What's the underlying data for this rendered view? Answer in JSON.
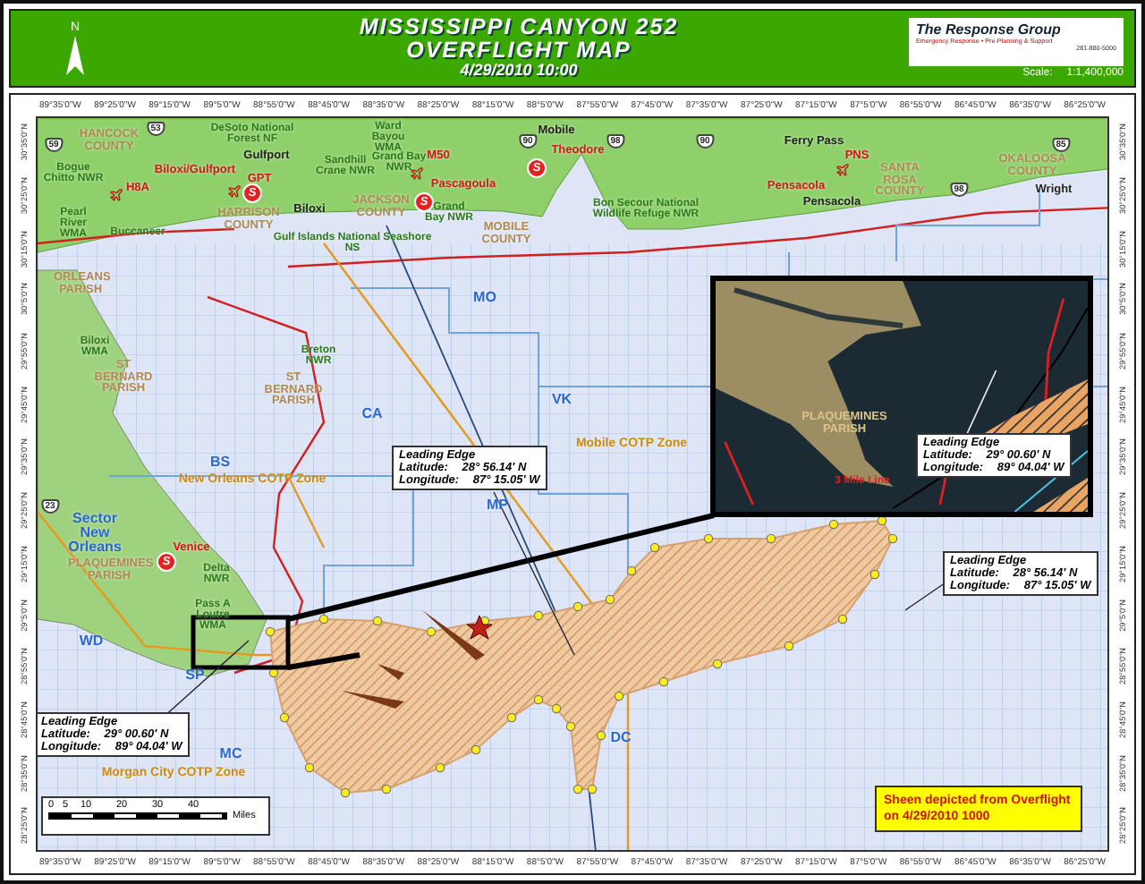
{
  "header": {
    "title_lines": [
      "MISSISSIPPI CANYON 252",
      "OVERFLIGHT MAP"
    ],
    "datetime": "4/29/2010 10:00",
    "north_label": "N",
    "logo": {
      "name": "The Response Group",
      "tagline": "Emergency Response • Pre-Planning & Support",
      "phone": "281-880-5000"
    },
    "scale_label": "Scale:",
    "scale_value": "1:1,400,000"
  },
  "map": {
    "lon_ticks_top": [
      "89°35'0\"W",
      "89°25'0\"W",
      "89°15'0\"W",
      "89°5'0\"W",
      "88°55'0\"W",
      "88°45'0\"W",
      "88°35'0\"W",
      "88°25'0\"W",
      "88°15'0\"W",
      "88°5'0\"W",
      "87°55'0\"W",
      "87°45'0\"W",
      "87°35'0\"W",
      "87°25'0\"W",
      "87°15'0\"W",
      "87°5'0\"W",
      "86°55'0\"W",
      "86°45'0\"W",
      "86°35'0\"W",
      "86°25'0\"W"
    ],
    "lon_ticks_bottom": [
      "89°35'0\"W",
      "89°25'0\"W",
      "89°15'0\"W",
      "89°5'0\"W",
      "88°55'0\"W",
      "88°45'0\"W",
      "88°35'0\"W",
      "88°25'0\"W",
      "88°15'0\"W",
      "88°5'0\"W",
      "87°55'0\"W",
      "87°45'0\"W",
      "87°35'0\"W",
      "87°25'0\"W",
      "87°15'0\"W",
      "87°5'0\"W",
      "86°55'0\"W",
      "86°45'0\"W",
      "86°35'0\"W",
      "86°25'0\"W"
    ],
    "lat_ticks_left": [
      "30°35'0\"N",
      "30°25'0\"N",
      "30°15'0\"N",
      "30°5'0\"N",
      "29°55'0\"N",
      "29°45'0\"N",
      "29°35'0\"N",
      "29°25'0\"N",
      "29°15'0\"N",
      "29°5'0\"N",
      "28°55'0\"N",
      "28°45'0\"N",
      "28°35'0\"N",
      "28°25'0\"N"
    ],
    "lat_ticks_right": [
      "30°35'0\"N",
      "30°25'0\"N",
      "30°15'0\"N",
      "30°5'0\"N",
      "29°55'0\"N",
      "29°45'0\"N",
      "29°35'0\"N",
      "29°25'0\"N",
      "29°15'0\"N",
      "29°5'0\"N",
      "28°55'0\"N",
      "28°45'0\"N",
      "28°35'0\"N",
      "28°25'0\"N"
    ],
    "place_labels": [
      {
        "text": "Bogue Chitto NWR",
        "kind": "land"
      },
      {
        "text": "HANCOCK COUNTY",
        "kind": "parish"
      },
      {
        "text": "DeSoto National Forest NF",
        "kind": "land"
      },
      {
        "text": "Ward Bayou WMA",
        "kind": "land"
      },
      {
        "text": "Mobile",
        "kind": "town"
      },
      {
        "text": "Theodore",
        "kind": "city"
      },
      {
        "text": "Ferry Pass",
        "kind": "town"
      },
      {
        "text": "PNS",
        "kind": "city"
      },
      {
        "text": "SANTA ROSA COUNTY",
        "kind": "parish"
      },
      {
        "text": "OKALOOSA COUNTY",
        "kind": "parish"
      },
      {
        "text": "Wright",
        "kind": "town"
      },
      {
        "text": "Biloxi/Gulfport",
        "kind": "city"
      },
      {
        "text": "Gulfport",
        "kind": "town"
      },
      {
        "text": "GPT",
        "kind": "city"
      },
      {
        "text": "Sandhill Crane NWR",
        "kind": "land"
      },
      {
        "text": "Grand Bay NWR",
        "kind": "land"
      },
      {
        "text": "M50",
        "kind": "city"
      },
      {
        "text": "Pascagoula",
        "kind": "city"
      },
      {
        "text": "Grand Bay NWR",
        "kind": "land"
      },
      {
        "text": "H8A",
        "kind": "city"
      },
      {
        "text": "Bon Secour National Wildlife Refuge NWR",
        "kind": "land"
      },
      {
        "text": "Pensacola",
        "kind": "city"
      },
      {
        "text": "Pensacola",
        "kind": "town"
      },
      {
        "text": "Pearl River WMA",
        "kind": "land"
      },
      {
        "text": "Buccaneer",
        "kind": "land"
      },
      {
        "text": "HARRISON COUNTY",
        "kind": "parish"
      },
      {
        "text": "Biloxi",
        "kind": "town"
      },
      {
        "text": "JACKSON COUNTY",
        "kind": "parish"
      },
      {
        "text": "MOBILE COUNTY",
        "kind": "parish"
      },
      {
        "text": "Gulf Islands National Seashore NS",
        "kind": "land"
      },
      {
        "text": "ORLEANS PARISH",
        "kind": "parish"
      },
      {
        "text": "MO",
        "kind": "area"
      },
      {
        "text": "Biloxi WMA",
        "kind": "land"
      },
      {
        "text": "ST BERNARD PARISH",
        "kind": "parish"
      },
      {
        "text": "Breton NWR",
        "kind": "land"
      },
      {
        "text": "ST BERNARD PARISH",
        "kind": "parish"
      },
      {
        "text": "CA",
        "kind": "area"
      },
      {
        "text": "VK",
        "kind": "area"
      },
      {
        "text": "BS",
        "kind": "area"
      },
      {
        "text": "New Orleans COTP Zone",
        "kind": "zone"
      },
      {
        "text": "Mobile COTP Zone",
        "kind": "zone"
      },
      {
        "text": "MP",
        "kind": "area"
      },
      {
        "text": "Sector New Orleans",
        "kind": "area"
      },
      {
        "text": "Venice",
        "kind": "city"
      },
      {
        "text": "PLAQUEMINES PARISH",
        "kind": "parish"
      },
      {
        "text": "Delta NWR",
        "kind": "land"
      },
      {
        "text": "Pass A Loutre WMA",
        "kind": "land"
      },
      {
        "text": "WD",
        "kind": "area"
      },
      {
        "text": "SP",
        "kind": "area"
      },
      {
        "text": "MC",
        "kind": "area"
      },
      {
        "text": "Morgan City COTP Zone",
        "kind": "zone"
      },
      {
        "text": "DC",
        "kind": "area"
      }
    ],
    "road_shields": [
      "59",
      "53",
      "90",
      "98",
      "90",
      "98",
      "85",
      "23"
    ],
    "station_markers": [
      "S",
      "S",
      "S",
      "S"
    ],
    "callouts": [
      {
        "title": "Leading Edge",
        "lines": [
          {
            "label": "Latitude:",
            "value": "28° 56.14' N"
          },
          {
            "label": "Longitude:",
            "value": "87° 15.05' W"
          }
        ]
      },
      {
        "title": "Leading Edge",
        "lines": [
          {
            "label": "Latitude:",
            "value": "28° 56.14' N"
          },
          {
            "label": "Longitude:",
            "value": "87° 15.05' W"
          }
        ]
      },
      {
        "title": "Leading Edge",
        "lines": [
          {
            "label": "Latitude:",
            "value": "29° 00.60' N"
          },
          {
            "label": "Longitude:",
            "value": "89° 04.04' W"
          }
        ]
      }
    ],
    "inset": {
      "labels": [
        {
          "text": "PLAQUEMINES PARISH",
          "kind": "parish"
        },
        {
          "text": "3 Mile Line",
          "kind": "line"
        }
      ],
      "callout": {
        "title": "Leading Edge",
        "lines": [
          {
            "label": "Latitude:",
            "value": "29° 00.60' N"
          },
          {
            "label": "Longitude:",
            "value": "89° 04.04' W"
          }
        ]
      }
    },
    "scale_bar": {
      "ticks": [
        "0",
        "5",
        "10",
        "20",
        "30",
        "40"
      ],
      "unit": "Miles"
    },
    "note": "Sheen depicted from Overflight on 4/29/2010 1000"
  }
}
